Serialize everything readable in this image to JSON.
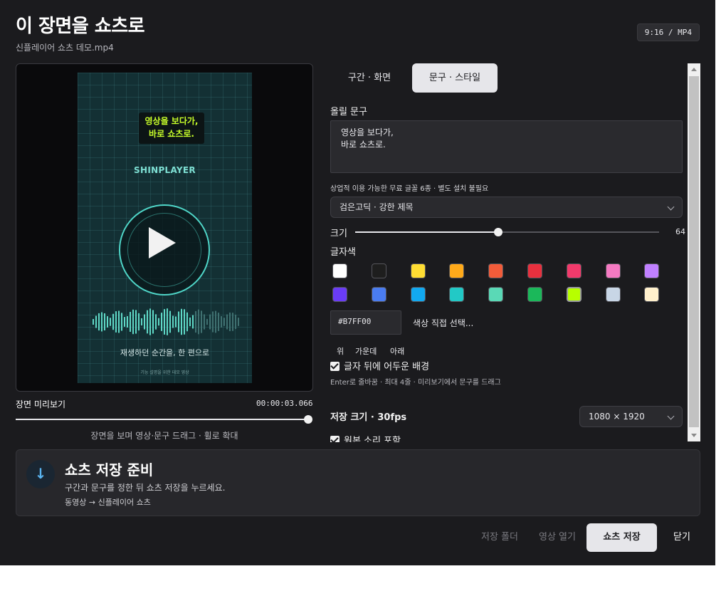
{
  "dialog": {
    "title": "이 장면을 쇼츠로",
    "filename": "신플레이어 쇼츠 데모.mp4",
    "badge": "9:16 / MP4"
  },
  "preview": {
    "caption_lines": [
      "영상을 보다가,",
      "바로 쇼츠로."
    ],
    "brand": "SHINPLAYER",
    "video_caption": "재생하던 순간을, 한 편으로",
    "video_footer": "기능 설명을 위한 데모 영상",
    "label": "장면 미리보기",
    "timecode": "00:00:03.066",
    "seek_progress": 0.98,
    "hint": "장면을 보며 영상·문구 드래그 · 휠로 확대"
  },
  "tabs": [
    {
      "label": "구간 · 화면",
      "active": false
    },
    {
      "label": "문구 · 스타일",
      "active": true
    }
  ],
  "text_panel": {
    "caption_label": "올릴 문구",
    "caption_lines": [
      "영상을 보다가,",
      "바로 쇼츠로."
    ],
    "font_note": "상업적 이용 가능한 무료 글꼴 6종 · 별도 설치 불필요",
    "font_select": "검은고딕 · 강한 제목",
    "size_label": "크기",
    "size_value": "64",
    "size_fraction": 0.47,
    "color_label": "글자색",
    "colors": [
      "#FFFFFF",
      "#1E1E1E",
      "#FFDD33",
      "#FFAA1A",
      "#F25C3A",
      "#E8303E",
      "#F23A6B",
      "#F57AC2",
      "#C080FF",
      "#6A3CF5",
      "#4A7CF0",
      "#12A9F0",
      "#22C9C6",
      "#5AD9B6",
      "#1BB85A",
      "#B7FF00",
      "#C8D6E6",
      "#FFF0CC"
    ],
    "selected_color_index": 15,
    "hex_value": "#B7FF00",
    "pick_label": "색상 직접 선택...",
    "positions": [
      "위",
      "가운데",
      "아래"
    ],
    "dark_bg_label": "글자 뒤에 어두운 배경",
    "dark_bg_checked": true,
    "enter_hint": "Enter로 줄바꿈 · 최대 4줄 · 미리보기에서 문구를 드래그",
    "save_size_label": "저장 크기 · 30fps",
    "save_size_select": "1080 × 1920",
    "audio_label": "원본 소리 포함",
    "audio_checked": true
  },
  "status": {
    "title": "쇼츠 저장 준비",
    "text": "구간과 문구를 정한 뒤 쇼츠 저장을 누르세요.",
    "path": "동영상 → 신플레이어 쇼츠"
  },
  "buttons": {
    "folder": "저장 폴더",
    "open": "영상 열기",
    "save": "쇼츠 저장",
    "close": "닫기"
  }
}
